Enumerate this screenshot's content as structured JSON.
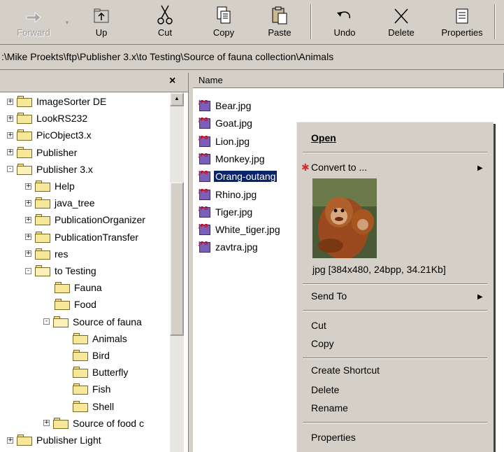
{
  "toolbar": {
    "forward": "Forward",
    "up": "Up",
    "cut": "Cut",
    "copy": "Copy",
    "paste": "Paste",
    "undo": "Undo",
    "delete": "Delete",
    "properties": "Properties"
  },
  "address": {
    "path": ":\\Mike Proekts\\ftp\\Publisher 3.x\\to Testing\\Source of fauna collection\\Animals"
  },
  "left_pane": {
    "close_glyph": "×",
    "tree": [
      {
        "label": "ImageSorter DE",
        "level": 0,
        "expander": "+"
      },
      {
        "label": "LookRS232",
        "level": 0,
        "expander": "+"
      },
      {
        "label": "PicObject3.x",
        "level": 0,
        "expander": "+"
      },
      {
        "label": "Publisher",
        "level": 0,
        "expander": "+"
      },
      {
        "label": "Publisher 3.x",
        "level": 0,
        "expander": "-"
      },
      {
        "label": "Help",
        "level": 1,
        "expander": "+"
      },
      {
        "label": "java_tree",
        "level": 1,
        "expander": "+"
      },
      {
        "label": "PublicationOrganizer",
        "level": 1,
        "expander": "+"
      },
      {
        "label": "PublicationTransfer",
        "level": 1,
        "expander": "+"
      },
      {
        "label": "res",
        "level": 1,
        "expander": "+"
      },
      {
        "label": "to Testing",
        "level": 1,
        "expander": "-"
      },
      {
        "label": "Fauna",
        "level": 2,
        "expander": ""
      },
      {
        "label": "Food",
        "level": 2,
        "expander": ""
      },
      {
        "label": "Source of fauna",
        "level": 2,
        "expander": "-"
      },
      {
        "label": "Animals",
        "level": 3,
        "expander": ""
      },
      {
        "label": "Bird",
        "level": 3,
        "expander": ""
      },
      {
        "label": "Butterfly",
        "level": 3,
        "expander": ""
      },
      {
        "label": "Fish",
        "level": 3,
        "expander": ""
      },
      {
        "label": "Shell",
        "level": 3,
        "expander": ""
      },
      {
        "label": "Source of food c",
        "level": 2,
        "expander": "+"
      },
      {
        "label": "Publisher Light",
        "level": 0,
        "expander": "+"
      }
    ]
  },
  "right_pane": {
    "column_name": "Name",
    "files": [
      {
        "label": "Bear.jpg"
      },
      {
        "label": "Goat.jpg"
      },
      {
        "label": "Lion.jpg"
      },
      {
        "label": "Monkey.jpg"
      },
      {
        "label": "Orang-outang"
      },
      {
        "label": "Rhino.jpg"
      },
      {
        "label": "Tiger.jpg"
      },
      {
        "label": "White_tiger.jpg"
      },
      {
        "label": "zavtra.jpg"
      }
    ]
  },
  "context_menu": {
    "open": "Open",
    "convert_to": "Convert to ...",
    "image_info": "jpg [384x480, 24bpp, 34.21Kb]",
    "send_to": "Send To",
    "cut": "Cut",
    "copy": "Copy",
    "create_shortcut": "Create Shortcut",
    "delete": "Delete",
    "rename": "Rename",
    "properties": "Properties",
    "submenu_arrow": "▶"
  },
  "colors": {
    "selection": "#0a246a",
    "face": "#d4d0c8",
    "folder": "#f7e79a"
  }
}
